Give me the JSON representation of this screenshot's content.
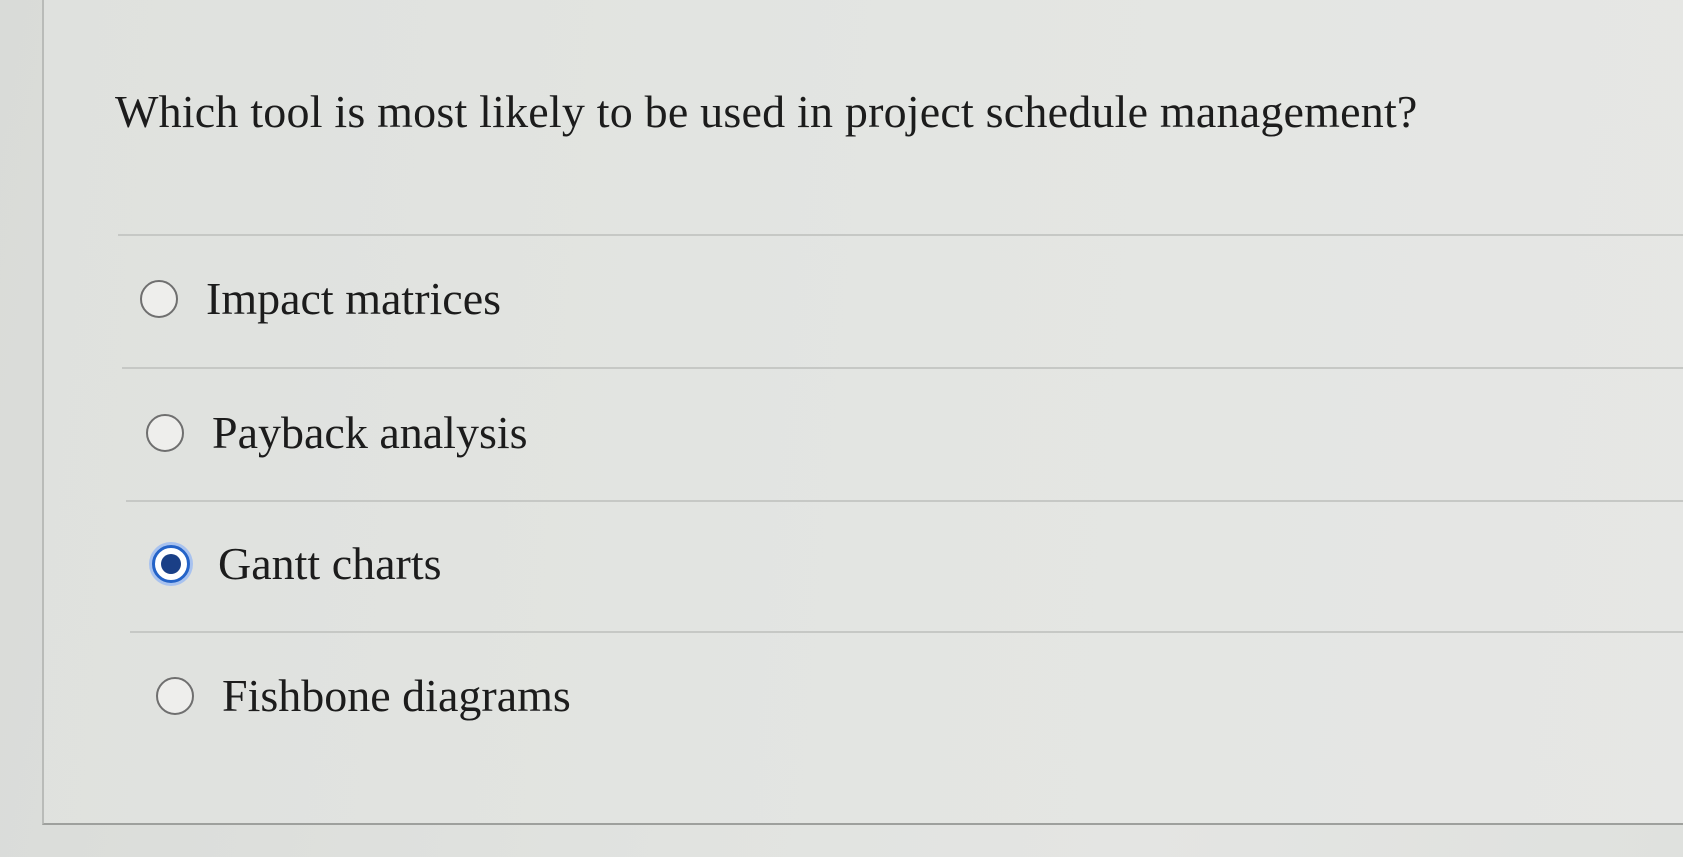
{
  "question": {
    "text": "Which tool is most likely to be used in project schedule management?"
  },
  "options": [
    {
      "label": "Impact matrices",
      "selected": false
    },
    {
      "label": "Payback analysis",
      "selected": false
    },
    {
      "label": "Gantt charts",
      "selected": true
    },
    {
      "label": "Fishbone diagrams",
      "selected": false
    }
  ],
  "colors": {
    "selected_accent": "#2463c8",
    "selected_dot": "#1a3f86",
    "text": "#1c1c1c"
  }
}
